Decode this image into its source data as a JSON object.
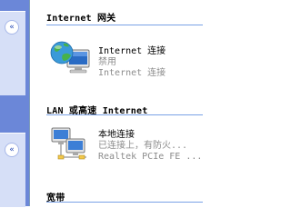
{
  "groups": [
    {
      "title": "Internet 网关",
      "items": [
        {
          "name": "Internet 连接",
          "status": "禁用",
          "device": "Internet 连接",
          "icon": "internet-globe-icon"
        }
      ]
    },
    {
      "title": "LAN 或高速 Internet",
      "items": [
        {
          "name": "本地连接",
          "status": "已连接上，有防火...",
          "device": "Realtek PCIe FE ...",
          "icon": "lan-connection-icon"
        }
      ]
    },
    {
      "title": "宽带",
      "items": []
    }
  ],
  "left_pane": {
    "collapse_glyph": "«"
  },
  "colors": {
    "task_pane": "#6b87d8",
    "task_panel": "#d6dff7",
    "group_rule": "#7aa1e6"
  }
}
